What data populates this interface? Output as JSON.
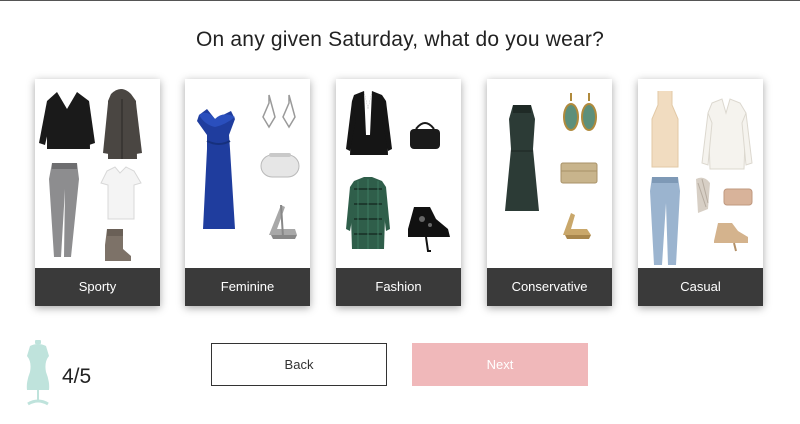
{
  "question": "On any given Saturday, what do you wear?",
  "styles": [
    {
      "label": "Sporty"
    },
    {
      "label": "Feminine"
    },
    {
      "label": "Fashion"
    },
    {
      "label": "Conservative"
    },
    {
      "label": "Casual"
    }
  ],
  "progress": {
    "text": "4/5",
    "current": 4,
    "total": 5
  },
  "buttons": {
    "back": "Back",
    "next": "Next"
  },
  "colors": {
    "card_label_bg": "#3a3a3a",
    "next_button": "#f0b8ba",
    "mannequin": "#bfe3dc"
  },
  "icons": {
    "progress": "dress-form-icon"
  }
}
